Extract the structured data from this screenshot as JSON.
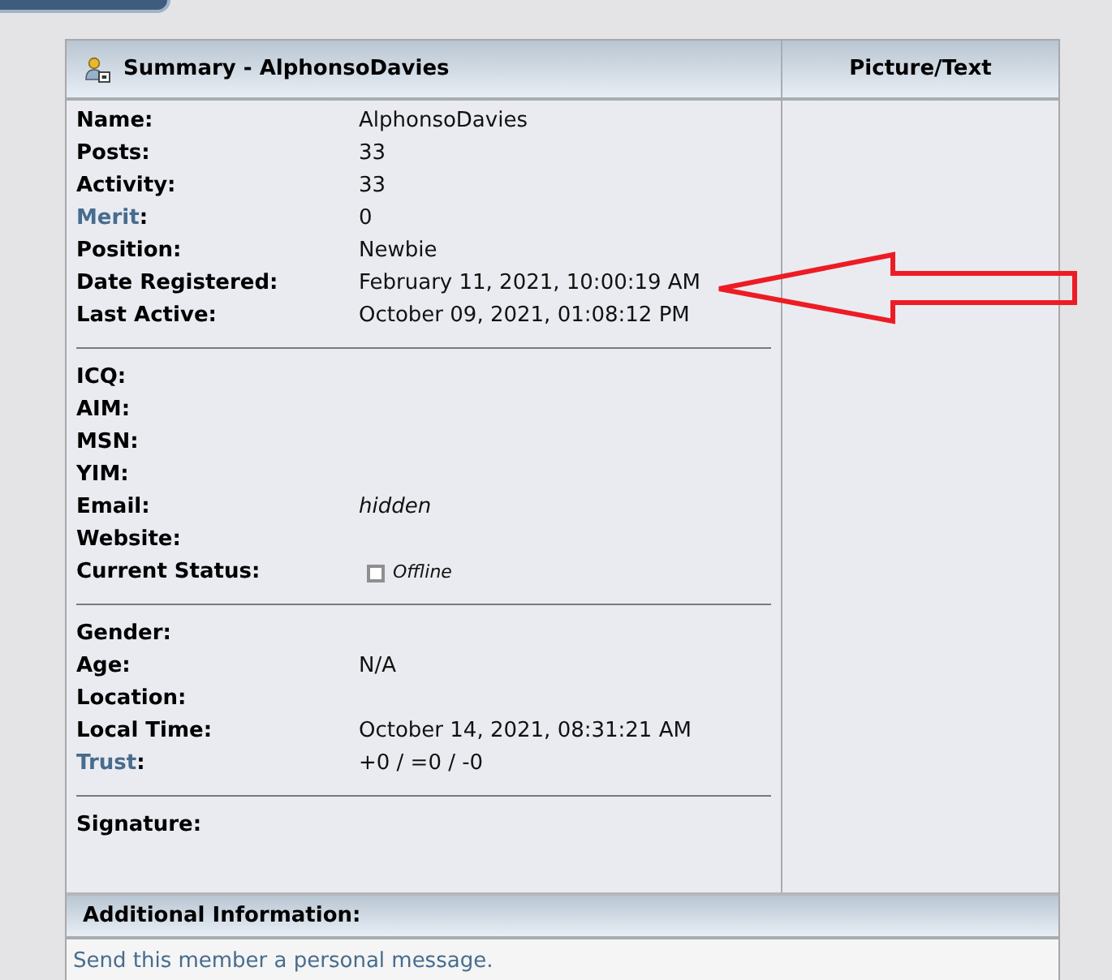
{
  "summary_panel": {
    "title": "Summary - AlphonsoDavies",
    "sections": [
      {
        "fields": [
          {
            "kind": "text",
            "label": "Name:",
            "value": "AlphonsoDavies"
          },
          {
            "kind": "text",
            "label": "Posts:",
            "value": "33"
          },
          {
            "kind": "text",
            "label": "Activity:",
            "value": "33"
          },
          {
            "kind": "text",
            "label_link": "Merit",
            "label": ":",
            "value": "0"
          },
          {
            "kind": "text",
            "label": "Position:",
            "value": "Newbie"
          },
          {
            "kind": "text",
            "label": "Date Registered:",
            "value": "February 11, 2021, 10:00:19 AM"
          },
          {
            "kind": "text",
            "label": "Last Active:",
            "value": "October 09, 2021, 01:08:12 PM"
          }
        ]
      },
      {
        "fields": [
          {
            "kind": "text",
            "label": "ICQ:"
          },
          {
            "kind": "text",
            "label": "AIM:"
          },
          {
            "kind": "text",
            "label": "MSN:"
          },
          {
            "kind": "text",
            "label": "YIM:"
          },
          {
            "kind": "italic",
            "label": "Email:",
            "value": "hidden"
          },
          {
            "kind": "text",
            "label": "Website:"
          },
          {
            "kind": "status",
            "label": "Current Status:",
            "value": "Offline",
            "online": false
          }
        ]
      },
      {
        "fields": [
          {
            "kind": "text",
            "label": "Gender:"
          },
          {
            "kind": "text",
            "label": "Age:",
            "value": "N/A"
          },
          {
            "kind": "text",
            "label": "Location:"
          },
          {
            "kind": "text",
            "label": "Local Time:",
            "value": "October 14, 2021, 08:31:21 AM"
          },
          {
            "kind": "text",
            "label_link": "Trust",
            "label": ":",
            "value": "+0 / =0 / -0"
          }
        ]
      },
      {
        "fields": [
          {
            "kind": "text",
            "label": "Signature:"
          }
        ]
      }
    ]
  },
  "picture_panel": {
    "title": "Picture/Text"
  },
  "additional_info": {
    "title": "Additional Information:",
    "links": [
      "Send this member a personal message."
    ]
  }
}
